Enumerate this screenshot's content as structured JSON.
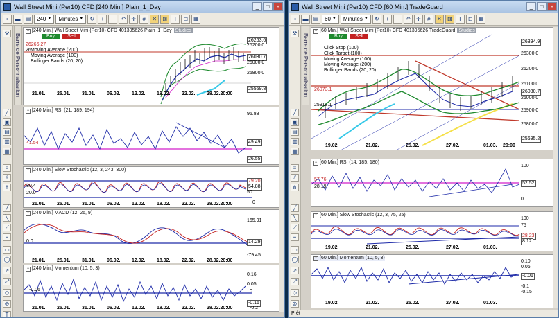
{
  "left_window": {
    "title": "Wall Street Mini (Per10) CFD [240 Min.]  Plain_1_Day",
    "toolbar": {
      "interval_value": "240",
      "unit": "Minutes"
    },
    "side_label": "Barre de Personnalisation",
    "main": {
      "title": "[240 Min.] Wall Street Mini (Per10) CFD  401395626 Plain_1_Day",
      "studies": "Studies",
      "buy": "Buy",
      "sell": "Sell",
      "price_marker": "26266.27",
      "legend": [
        "Moving Average (200)",
        "Moving Average (100)",
        "Bollinger Bands (20, 20)"
      ],
      "legend_prefix": "26",
      "price_labels": [
        "26263.6",
        "26200.0",
        "26030.7",
        "26000.0",
        "25800.0",
        "25559.8"
      ],
      "xlabels": [
        "21.01.",
        "25.01.",
        "31.01.",
        "06.02.",
        "12.02.",
        "18.02.",
        "22.02.",
        "28.02.20:00"
      ]
    },
    "rsi": {
      "title": "[240 Min.] RSI  (21, 189, 194)",
      "labels": [
        "95.88",
        "49.49",
        "26.55"
      ],
      "level_label": "41.54",
      "sub": "20.0"
    },
    "stoch": {
      "title": "[240 Min.] Slow Stochastic  (12, 3, 243, 300)",
      "labels": [
        "79.20",
        "54.88",
        "50",
        "0"
      ],
      "left_labels": [
        "80.4",
        "20.0"
      ]
    },
    "macd": {
      "title": "[240 Min.] MACD  (12, 26, 9)",
      "labels": [
        "165.91",
        "14.29",
        "-79.45"
      ],
      "left_label": "0.0"
    },
    "momentum": {
      "title": "[240 Min.] Momentum  (10, 5, 3)",
      "labels": [
        "0.16",
        "0.05",
        "0",
        "-0.16"
      ],
      "left_label": "-0.06",
      "bottom_label": "-0.2"
    }
  },
  "right_window": {
    "title": "Wall Street Mini (Per10) CFD [60 Min.]  TradeGuard",
    "toolbar": {
      "interval_value": "60",
      "unit": "Minutes"
    },
    "side_label": "Barre de Personnalisation",
    "main": {
      "title": "[60 Min.] Wall Street Mini (Per10) CFD  401395626 TradeGuard",
      "studies": "Studies",
      "buy": "Buy",
      "sell": "Sell",
      "legend": [
        "Click Stop (100)",
        "Click Target (100)",
        "Moving Average (100)",
        "Moving Average (200)",
        "Bollinger Bands (20, 20)"
      ],
      "left_prices": [
        "26073.1",
        "25913.1"
      ],
      "price_labels": [
        "26394.9",
        "26300.0",
        "26200.0",
        "26100.0",
        "26030.7",
        "26000.0",
        "25900.0",
        "25800.0",
        "25695.2"
      ],
      "xlabels": [
        "19.02.",
        "21.02.",
        "25.02.",
        "27.02.",
        "01.03.",
        "20:00"
      ]
    },
    "rsi": {
      "title": "[60 Min.] RSI  (14, 185, 180)",
      "labels": [
        "100",
        "52.52",
        "0"
      ],
      "left_labels": [
        "57.76",
        "28.19"
      ]
    },
    "stoch": {
      "title": "[60 Min.] Slow Stochastic  (12, 3, 75, 25)",
      "labels": [
        "100",
        "75",
        "28.23",
        "8.12"
      ]
    },
    "momentum": {
      "title": "[60 Min.] Momentum  (10, 5, 3)",
      "labels": [
        "0.10",
        "0.06",
        "-0.01",
        "-0.1",
        "-0.15"
      ]
    },
    "status": "Prêt"
  },
  "colors": {
    "accent": "#1e8a2e",
    "sell": "#c42222",
    "indicator_blue": "#1d2aa8",
    "level_magenta": "#d21fc9",
    "price_red": "#c0392b"
  }
}
